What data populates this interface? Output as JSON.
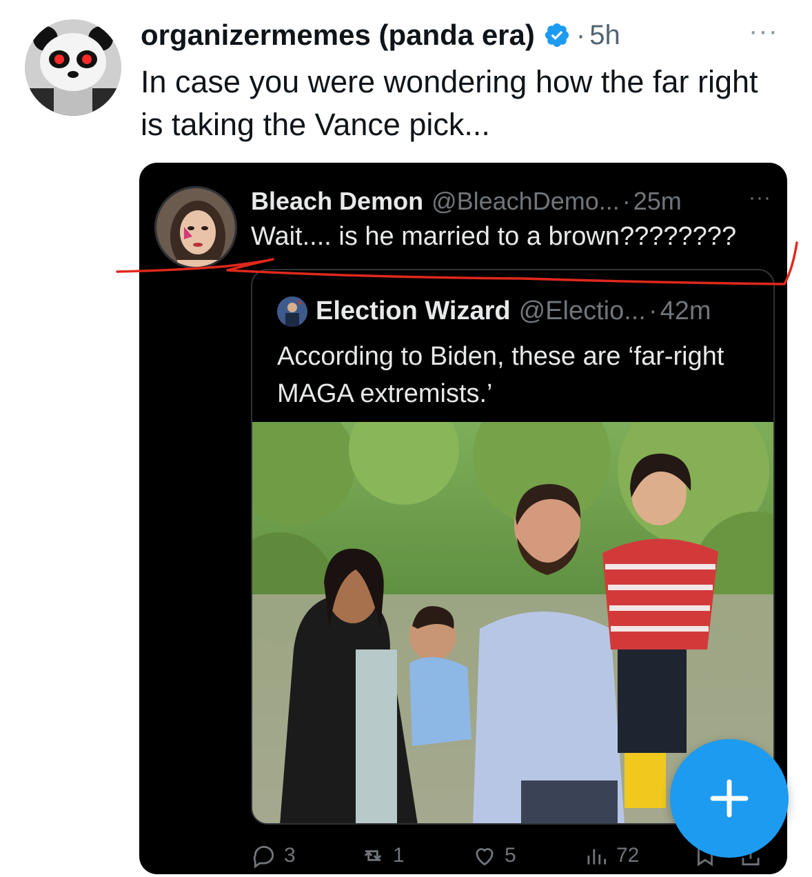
{
  "tweet": {
    "display_name": "organizermemes (panda era)",
    "dot": "·",
    "time": "5h",
    "more": "···",
    "text": "In case you were wondering how the far right is taking the Vance pick..."
  },
  "embedded": {
    "reply": {
      "display_name": "Bleach Demon",
      "handle": "@BleachDemo...",
      "dot": "·",
      "time": "25m",
      "more": "···",
      "text": "Wait.... is he married to a brown????????"
    },
    "quoted": {
      "display_name": "Election Wizard",
      "handle": "@Electio...",
      "dot": "·",
      "time": "42m",
      "text": "According to Biden, these are ‘far-right MAGA extremists.’"
    },
    "actions": {
      "replies": "3",
      "reposts": "1",
      "likes": "5",
      "views": "72"
    }
  },
  "colors": {
    "accent": "#1d9bf0",
    "annotation": "#e0281c",
    "card_bg": "#000000",
    "muted": "#71767b"
  },
  "icons": [
    "panda-avatar",
    "verified-badge-icon",
    "more-icon",
    "reply-icon",
    "repost-icon",
    "like-icon",
    "views-icon",
    "bookmark-icon",
    "share-icon",
    "compose-plus-icon"
  ]
}
